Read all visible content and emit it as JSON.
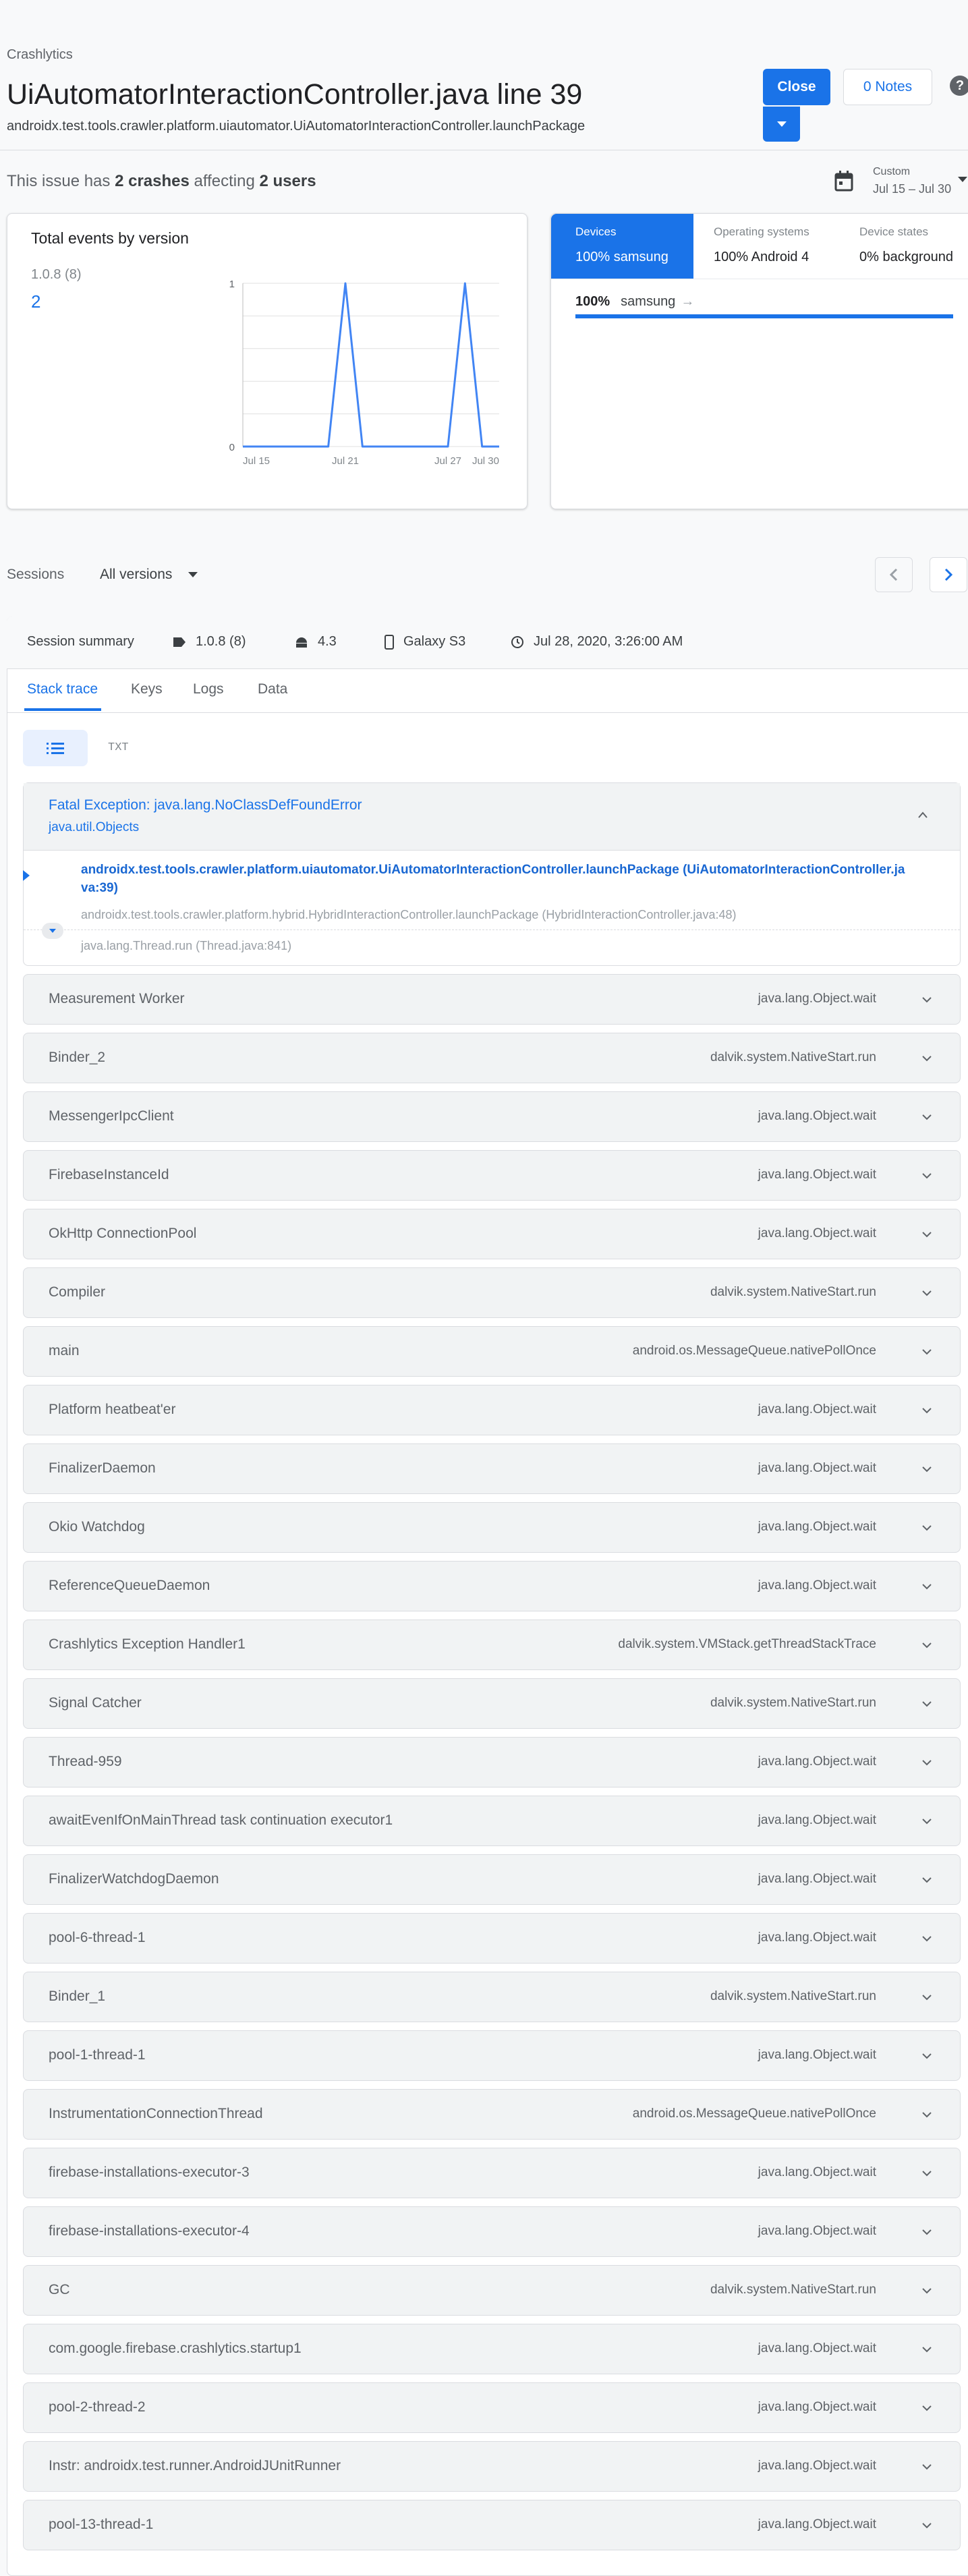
{
  "header": {
    "breadcrumb": "Crashlytics",
    "title": "UiAutomatorInteractionController.java line 39",
    "subtitle": "androidx.test.tools.crawler.platform.uiautomator.UiAutomatorInteractionController.launchPackage",
    "close_label": "Close",
    "notes_label": "0 Notes",
    "help_label": "?"
  },
  "issue": {
    "prefix": "This issue has ",
    "crashes": "2 crashes",
    "middle": " affecting ",
    "users": "2 users",
    "range_label": "Custom",
    "range_value": "Jul 15 – Jul 30"
  },
  "events": {
    "title": "Total events by version",
    "version": "1.0.8 (8)",
    "count": "2"
  },
  "chart_data": {
    "type": "line",
    "x": [
      "Jul 15",
      "Jul 16",
      "Jul 17",
      "Jul 18",
      "Jul 19",
      "Jul 20",
      "Jul 21",
      "Jul 22",
      "Jul 23",
      "Jul 24",
      "Jul 25",
      "Jul 26",
      "Jul 27",
      "Jul 28",
      "Jul 29",
      "Jul 30"
    ],
    "x_tick_labels": [
      "Jul 15",
      "Jul 21",
      "Jul 27",
      "Jul 30"
    ],
    "series": [
      {
        "values": [
          0,
          0,
          0,
          0,
          0,
          0,
          1,
          0,
          0,
          0,
          0,
          0,
          0,
          1,
          0,
          0
        ],
        "color": "#4285f4"
      }
    ],
    "y_tick_labels": [
      "1",
      "0"
    ],
    "ylim": [
      0,
      1
    ],
    "grid": true
  },
  "devices": {
    "tabs": [
      {
        "label": "Devices",
        "value": "100% samsung"
      },
      {
        "label": "Operating systems",
        "value": "100% Android 4"
      },
      {
        "label": "Device states",
        "value": "0% background"
      }
    ],
    "bar_pct": "100%",
    "bar_name": "samsung",
    "bar_arrow": "→",
    "bar_fraction": 1.0
  },
  "sessions": {
    "label": "Sessions",
    "filter": "All versions",
    "summary_label": "Session summary",
    "version": "1.0.8 (8)",
    "os": "4.3",
    "device": "Galaxy S3",
    "date": "Jul 28, 2020, 3:26:00 AM",
    "tabs": [
      "Stack trace",
      "Keys",
      "Logs",
      "Data"
    ],
    "txt_label": "TXT"
  },
  "exception": {
    "title": "Fatal Exception: java.lang.NoClassDefFoundError",
    "subtitle": "java.util.Objects",
    "frame1": "androidx.test.tools.crawler.platform.uiautomator.UiAutomatorInteractionController.launchPackage (UiAutomatorInteractionController.java:39)",
    "frame2": "androidx.test.tools.crawler.platform.hybrid.HybridInteractionController.launchPackage (HybridInteractionController.java:48)",
    "frame3": "java.lang.Thread.run (Thread.java:841)"
  },
  "threads": [
    {
      "name": "Measurement Worker",
      "method": "java.lang.Object.wait"
    },
    {
      "name": "Binder_2",
      "method": "dalvik.system.NativeStart.run"
    },
    {
      "name": "MessengerIpcClient",
      "method": "java.lang.Object.wait"
    },
    {
      "name": "FirebaseInstanceId",
      "method": "java.lang.Object.wait"
    },
    {
      "name": "OkHttp ConnectionPool",
      "method": "java.lang.Object.wait"
    },
    {
      "name": "Compiler",
      "method": "dalvik.system.NativeStart.run"
    },
    {
      "name": "main",
      "method": "android.os.MessageQueue.nativePollOnce"
    },
    {
      "name": "Platform heatbeat'er",
      "method": "java.lang.Object.wait"
    },
    {
      "name": "FinalizerDaemon",
      "method": "java.lang.Object.wait"
    },
    {
      "name": "Okio Watchdog",
      "method": "java.lang.Object.wait"
    },
    {
      "name": "ReferenceQueueDaemon",
      "method": "java.lang.Object.wait"
    },
    {
      "name": "Crashlytics Exception Handler1",
      "method": "dalvik.system.VMStack.getThreadStackTrace"
    },
    {
      "name": "Signal Catcher",
      "method": "dalvik.system.NativeStart.run"
    },
    {
      "name": "Thread-959",
      "method": "java.lang.Object.wait"
    },
    {
      "name": "awaitEvenIfOnMainThread task continuation executor1",
      "method": "java.lang.Object.wait"
    },
    {
      "name": "FinalizerWatchdogDaemon",
      "method": "java.lang.Object.wait"
    },
    {
      "name": "pool-6-thread-1",
      "method": "java.lang.Object.wait"
    },
    {
      "name": "Binder_1",
      "method": "dalvik.system.NativeStart.run"
    },
    {
      "name": "pool-1-thread-1",
      "method": "java.lang.Object.wait"
    },
    {
      "name": "InstrumentationConnectionThread",
      "method": "android.os.MessageQueue.nativePollOnce"
    },
    {
      "name": "firebase-installations-executor-3",
      "method": "java.lang.Object.wait"
    },
    {
      "name": "firebase-installations-executor-4",
      "method": "java.lang.Object.wait"
    },
    {
      "name": "GC",
      "method": "dalvik.system.NativeStart.run"
    },
    {
      "name": "com.google.firebase.crashlytics.startup1",
      "method": "java.lang.Object.wait"
    },
    {
      "name": "pool-2-thread-2",
      "method": "java.lang.Object.wait"
    },
    {
      "name": "Instr: androidx.test.runner.AndroidJUnitRunner",
      "method": "java.lang.Object.wait"
    },
    {
      "name": "pool-13-thread-1",
      "method": "java.lang.Object.wait"
    }
  ]
}
